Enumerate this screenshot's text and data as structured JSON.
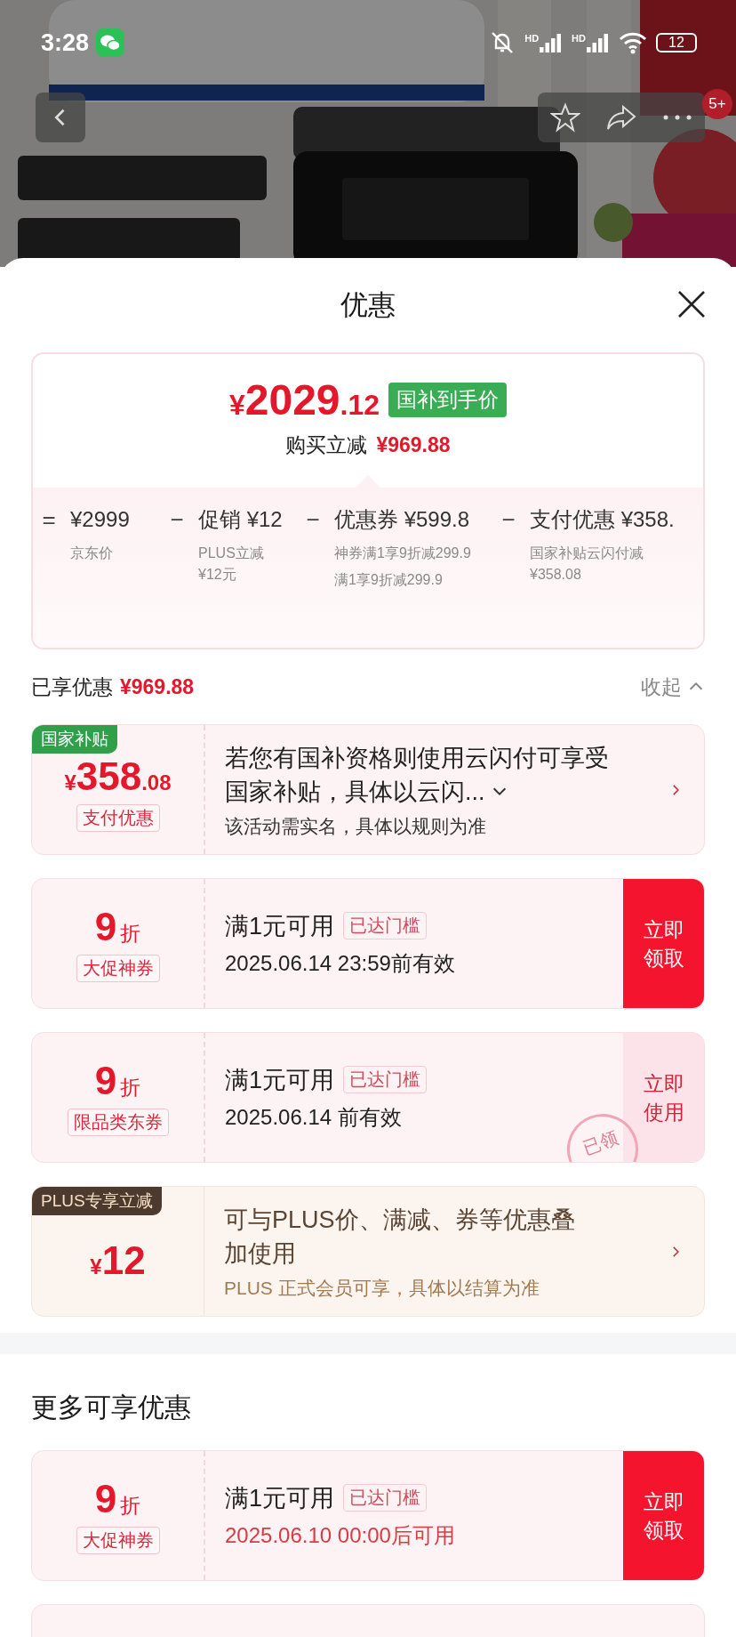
{
  "status_bar": {
    "time": "3:28",
    "signals": [
      {
        "label": "HD"
      },
      {
        "label": "HD"
      }
    ],
    "battery": "12"
  },
  "nav": {
    "badge": "5+"
  },
  "sheet": {
    "title": "优惠"
  },
  "summary": {
    "currency": "¥",
    "price_int": "2029",
    "price_dec": ".12",
    "price_tag": "国补到手价",
    "saving_label": "购买立减",
    "saving_value": "¥969.88",
    "breakdown": [
      {
        "op": "=",
        "amount": "¥2999",
        "notes": [
          "京东价"
        ]
      },
      {
        "op": "−",
        "label": "促销",
        "amount": "¥12",
        "notes": [
          "PLUS立减¥12元"
        ]
      },
      {
        "op": "−",
        "label": "优惠券",
        "amount": "¥599.8",
        "notes": [
          "神券满1享9折减299.9",
          "满1享9折减299.9"
        ]
      },
      {
        "op": "−",
        "label": "支付优惠",
        "amount": "¥358.",
        "notes": [
          "国家补贴云闪付减¥358.08"
        ]
      }
    ]
  },
  "applied": {
    "label": "已享优惠",
    "value": "¥969.88",
    "toggle": "收起",
    "expanded": true
  },
  "offers": [
    {
      "kind": "subsidy",
      "tag": "国家补贴",
      "currency": "¥",
      "amount": "358",
      "amount_dec": ".08",
      "type_label": "支付优惠",
      "title": "若您有国补资格则使用云闪付可享受国家补贴，具体以云闪...",
      "note": "该活动需实名，具体以规则为准"
    },
    {
      "kind": "coupon",
      "rate": "9",
      "rate_unit": "折",
      "type_label": "大促神券",
      "condition": "满1元可用",
      "badge": "已达门槛",
      "validity": "2025.06.14 23:59前有效",
      "validity_highlight": false,
      "action": "立即领取",
      "action_primary": true
    },
    {
      "kind": "coupon",
      "rate": "9",
      "rate_unit": "折",
      "type_label": "限品类东券",
      "condition": "满1元可用",
      "badge": "已达门槛",
      "validity": "2025.06.14 前有效",
      "validity_highlight": false,
      "action": "立即使用",
      "action_primary": false,
      "stamp": "已领"
    },
    {
      "kind": "plus",
      "tag": "PLUS专享立减",
      "currency": "¥",
      "amount": "12",
      "title": "可与PLUS价、满减、券等优惠叠加使用",
      "note": "PLUS 正式会员可享，具体以结算为准"
    }
  ],
  "more": {
    "title": "更多可享优惠",
    "offers": [
      {
        "kind": "coupon",
        "rate": "9",
        "rate_unit": "折",
        "type_label": "大促神券",
        "condition": "满1元可用",
        "badge": "已达门槛",
        "validity": "2025.06.10 00:00后可用",
        "validity_highlight": true,
        "action": "立即领取",
        "action_primary": true
      }
    ]
  }
}
